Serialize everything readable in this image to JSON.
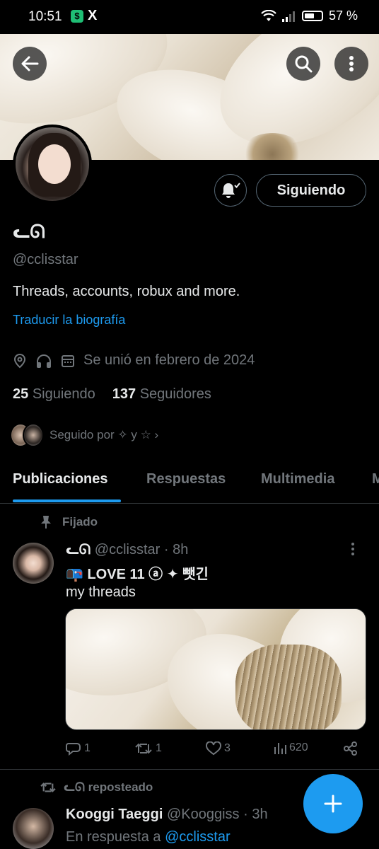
{
  "status_bar": {
    "time": "10:51",
    "app_icon": "money-app-icon",
    "x_icon": "X",
    "battery": "57 %",
    "battery_level": 0.57
  },
  "header": {
    "back_icon": "arrow-left-icon",
    "search_icon": "search-icon",
    "more_icon": "more-vertical-icon"
  },
  "profile": {
    "name": "ᓚᘏ",
    "handle": "@cclisstar",
    "bio": "Threads, accounts, robux and more.",
    "translate": "Traducir la biografía",
    "joined": "Se unió en febrero de 2024",
    "following_count": "25",
    "following_label": "Siguiendo",
    "followers_count": "137",
    "followers_label": "Seguidores",
    "followed_by": "Seguido por ✧ y ☆ ›",
    "follow_button": "Siguiendo"
  },
  "tabs": [
    "Publicaciones",
    "Respuestas",
    "Multimedia",
    "M"
  ],
  "pinned_tweet": {
    "pinned_label": "Fijado",
    "name": "ᓚᘏ",
    "handle": "@cclisstar",
    "time": "· 8h",
    "line1": "📭   LOVE  11   ⓐ       ✦     뺏긴",
    "line2": "my threads",
    "replies": "1",
    "retweets": "1",
    "likes": "3",
    "views": "620"
  },
  "second_tweet": {
    "reposted_label": "ᓚᘏ reposteado",
    "name": "Kooggi Taeggi",
    "handle": "@Kooggiss",
    "time": "· 3h",
    "reply_prefix": "En respuesta a",
    "reply_to": "@cclisstar"
  },
  "colors": {
    "accent": "#1d9bf0",
    "muted": "#71767b",
    "text": "#e7e9ea",
    "border": "#2f3336"
  }
}
